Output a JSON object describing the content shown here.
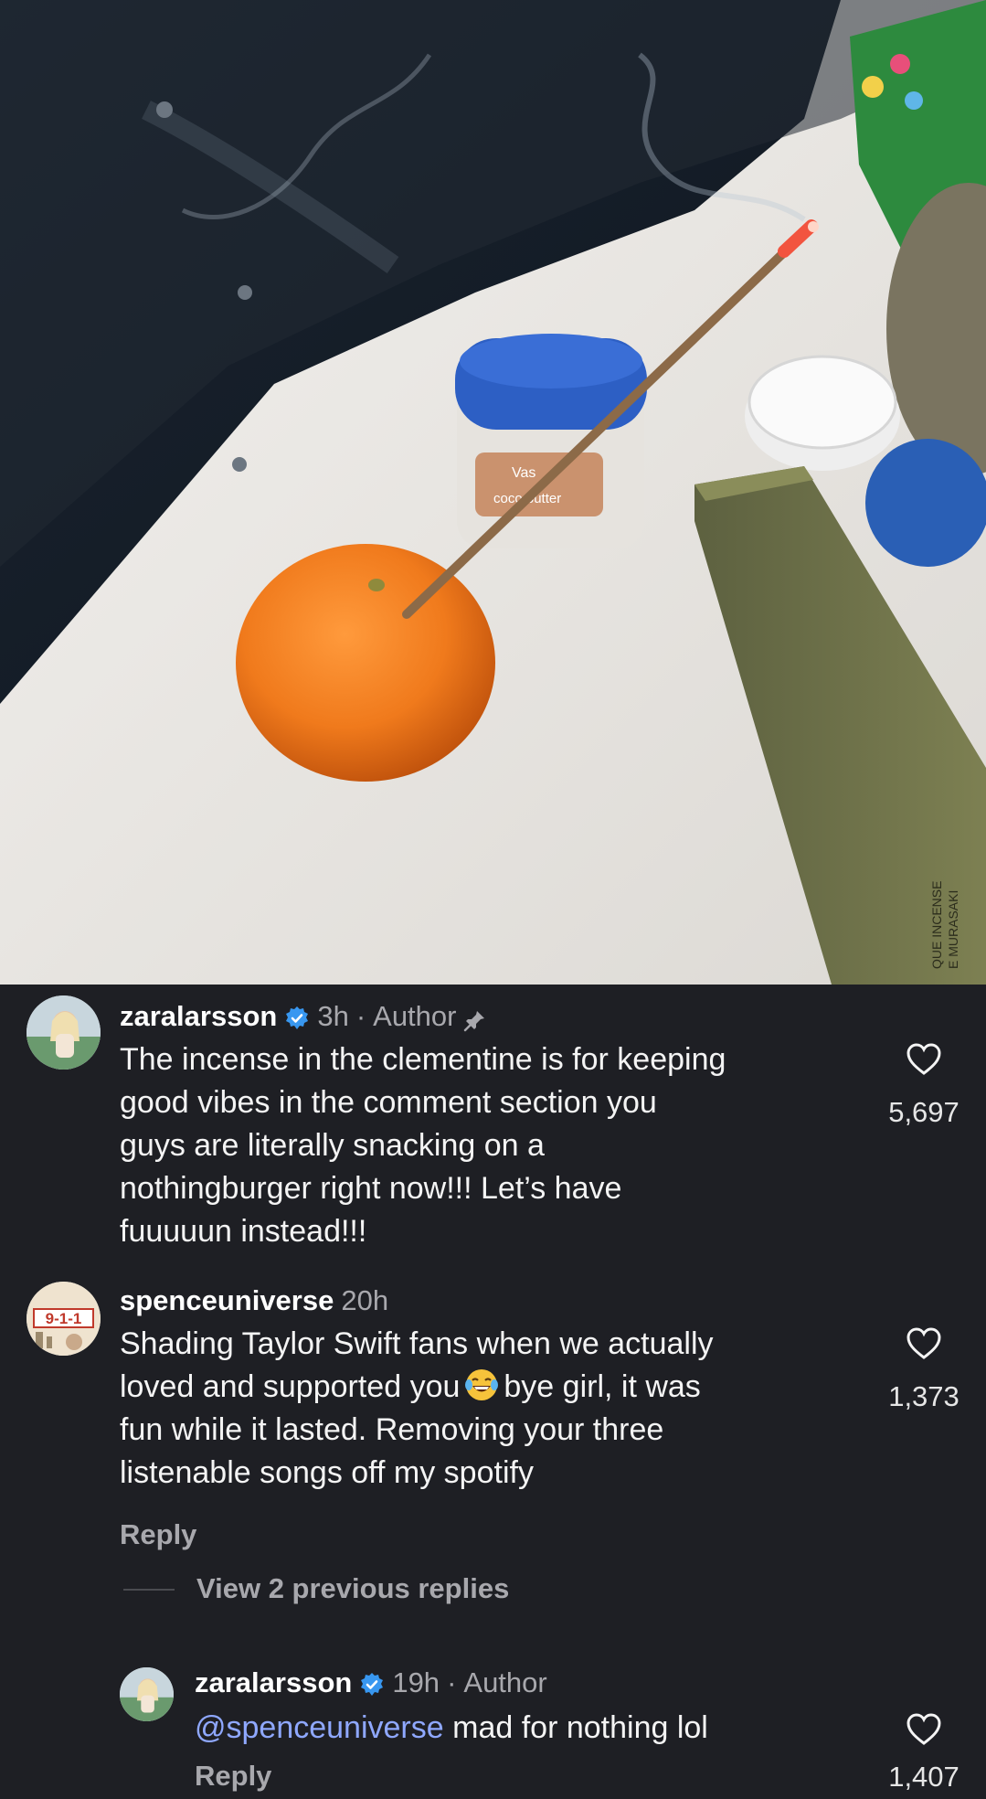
{
  "photo": {
    "description_icon": "incense-clementine-photo",
    "jar_label_brand": "Vas",
    "jar_label_text": "coco butter",
    "box_text_line1": "QUE INCENSE",
    "box_text_line2": "E MURASAKI"
  },
  "comments": [
    {
      "username": "zaralarsson",
      "verified": true,
      "time": "3h",
      "author_label": "Author",
      "pinned": true,
      "lines": [
        "The incense in the clementine is for keeping",
        "good vibes in the comment section you",
        "guys are literally snacking on a",
        "nothingburger right now!!! Let’s have",
        "fuuuuun instead!!!"
      ],
      "likes": "5,697"
    },
    {
      "username": "spenceuniverse",
      "verified": false,
      "time": "20h",
      "avatar_text": "9-1-1",
      "lines": [
        "Shading Taylor Swift fans when we actually",
        "loved and supported you",
        "bye girl, it was",
        "fun while it lasted. Removing your three",
        "listenable songs off my spotify"
      ],
      "likes": "1,373",
      "reply_label": "Reply",
      "view_replies_label": "View 2 previous replies"
    },
    {
      "username": "zaralarsson",
      "verified": true,
      "time": "19h",
      "author_label": "Author",
      "mention": "@spenceuniverse",
      "text": "mad for nothing lol",
      "likes": "1,407",
      "reply_label": "Reply"
    }
  ],
  "colors": {
    "background": "#1e1f24",
    "verified_badge": "#3897f0",
    "mention": "#8fa8ff",
    "muted_text": "#a8a8ad"
  }
}
